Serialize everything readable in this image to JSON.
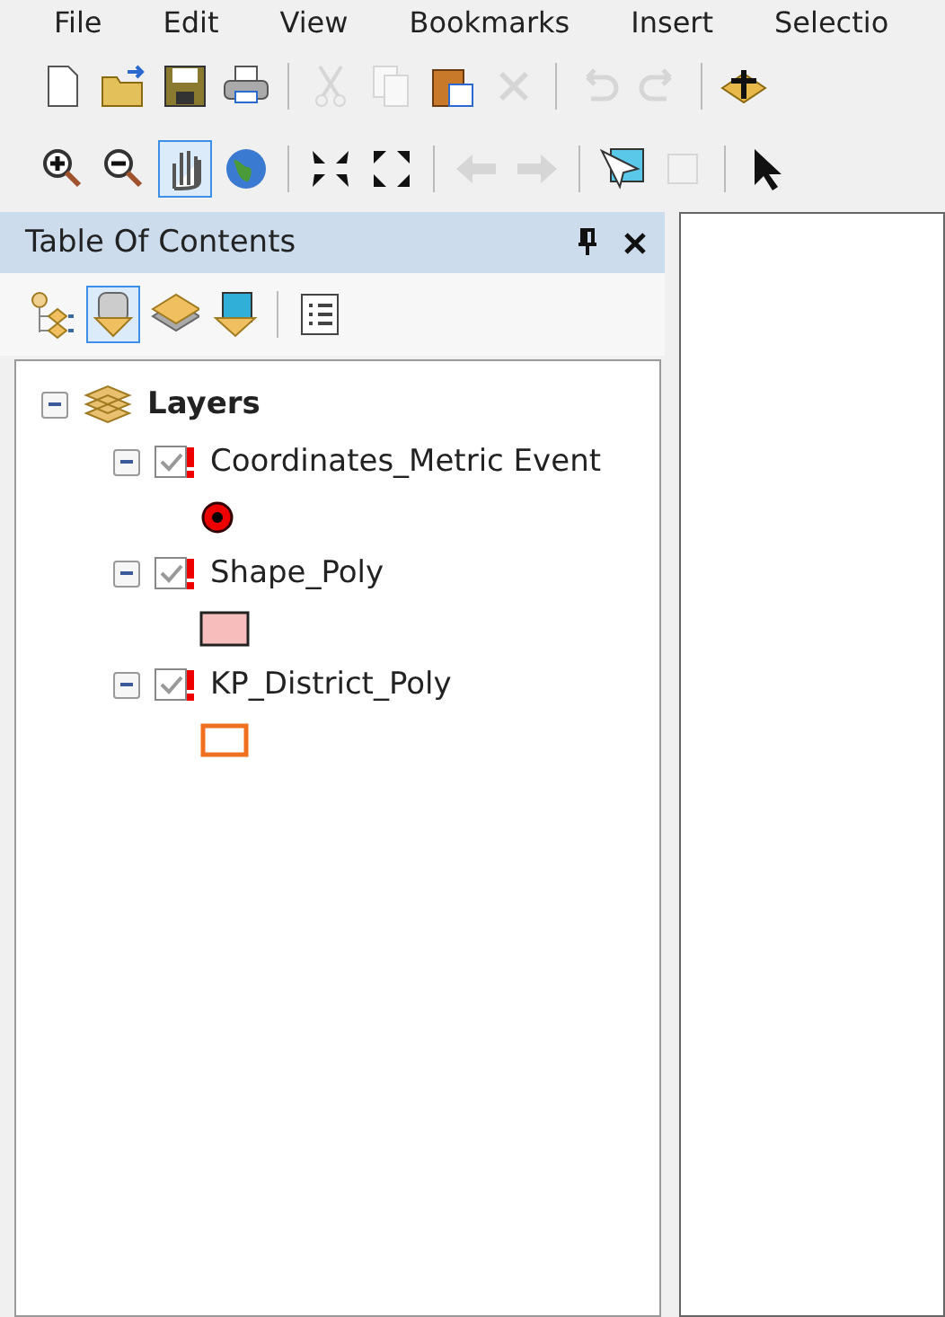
{
  "menu_bar": [
    "File",
    "Edit",
    "View",
    "Bookmarks",
    "Insert",
    "Selectio"
  ],
  "toolbars": [
    [
      {
        "kind": "new",
        "disabled": false,
        "selected": false
      },
      {
        "kind": "open",
        "disabled": false,
        "selected": false
      },
      {
        "kind": "save",
        "disabled": false,
        "selected": false
      },
      {
        "kind": "print",
        "disabled": false,
        "selected": false
      },
      {
        "kind": "sep"
      },
      {
        "kind": "cut",
        "disabled": true,
        "selected": false
      },
      {
        "kind": "copy",
        "disabled": true,
        "selected": false
      },
      {
        "kind": "paste",
        "disabled": false,
        "selected": false
      },
      {
        "kind": "delete",
        "disabled": true,
        "selected": false
      },
      {
        "kind": "sep"
      },
      {
        "kind": "undo",
        "disabled": true,
        "selected": false
      },
      {
        "kind": "redo",
        "disabled": true,
        "selected": false
      },
      {
        "kind": "sep"
      },
      {
        "kind": "add",
        "disabled": false,
        "selected": false
      }
    ],
    [
      {
        "kind": "zoomin",
        "disabled": false,
        "selected": false
      },
      {
        "kind": "zoomout",
        "disabled": false,
        "selected": false
      },
      {
        "kind": "pan",
        "disabled": false,
        "selected": true
      },
      {
        "kind": "globe",
        "disabled": false,
        "selected": false
      },
      {
        "kind": "sep"
      },
      {
        "kind": "shrink",
        "disabled": false,
        "selected": false
      },
      {
        "kind": "expand",
        "disabled": false,
        "selected": false
      },
      {
        "kind": "sep"
      },
      {
        "kind": "back",
        "disabled": true,
        "selected": false
      },
      {
        "kind": "forward",
        "disabled": true,
        "selected": false
      },
      {
        "kind": "sep"
      },
      {
        "kind": "selectfeat",
        "disabled": false,
        "selected": false
      },
      {
        "kind": "clearsel",
        "disabled": true,
        "selected": false
      },
      {
        "kind": "sep"
      },
      {
        "kind": "pointer",
        "disabled": false,
        "selected": false
      }
    ]
  ],
  "toc": {
    "title": "Table Of Contents",
    "tools": [
      {
        "kind": "drawing-order",
        "selected": false
      },
      {
        "kind": "source",
        "selected": true
      },
      {
        "kind": "visibility",
        "selected": false
      },
      {
        "kind": "selection",
        "selected": false
      },
      {
        "kind": "sep"
      },
      {
        "kind": "options",
        "selected": false
      }
    ],
    "root": {
      "label": "Layers",
      "expanded": true,
      "children": [
        {
          "label": "Coordinates_Metric Event",
          "checked": true,
          "broken": true,
          "expanded": true,
          "kind": "marker"
        },
        {
          "label": "Shape_Poly",
          "checked": true,
          "broken": true,
          "expanded": true,
          "kind": "fill"
        },
        {
          "label": "KP_District_Poly",
          "checked": true,
          "broken": true,
          "expanded": true,
          "kind": "outline"
        }
      ]
    }
  }
}
